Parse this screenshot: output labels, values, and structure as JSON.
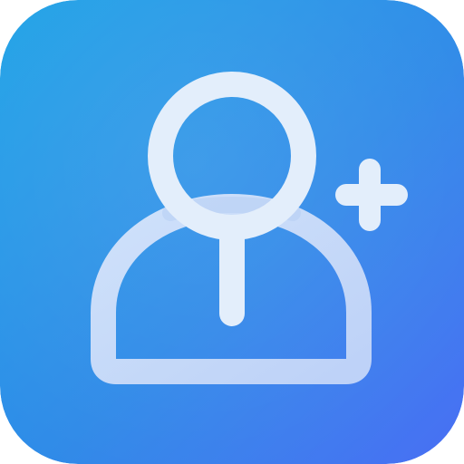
{
  "app_icon": {
    "name": "add-user-search",
    "icons": [
      "user-search-icon",
      "plus-icon"
    ],
    "colors": {
      "background_top_left": "#1ea2e6",
      "background_bottom_right": "#4a6ff4",
      "glyph": "#e3eefb",
      "glyph_shadow": "#b7cdf4"
    }
  }
}
